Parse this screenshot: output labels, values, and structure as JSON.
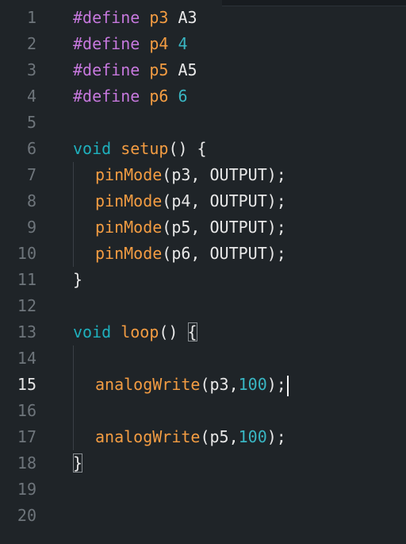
{
  "editor": {
    "current_line": 15,
    "line_numbers": [
      "1",
      "2",
      "3",
      "4",
      "5",
      "6",
      "7",
      "8",
      "9",
      "10",
      "11",
      "12",
      "13",
      "14",
      "15",
      "16",
      "17",
      "18",
      "19",
      "20"
    ],
    "lines": [
      {
        "define": "#define",
        "name": "p3",
        "value": "A3"
      },
      {
        "define": "#define",
        "name": "p4",
        "value": "4"
      },
      {
        "define": "#define",
        "name": "p5",
        "value": "A5"
      },
      {
        "define": "#define",
        "name": "p6",
        "value": "6"
      },
      {},
      {
        "type": "void",
        "func": "setup",
        "rest": "() {"
      },
      {
        "func": "pinMode",
        "rest": "(p3, OUTPUT);"
      },
      {
        "func": "pinMode",
        "rest": "(p4, OUTPUT);"
      },
      {
        "func": "pinMode",
        "rest": "(p5, OUTPUT);"
      },
      {
        "func": "pinMode",
        "rest": "(p6, OUTPUT);"
      },
      {
        "rest": "}"
      },
      {},
      {
        "type": "void",
        "func": "loop",
        "rest": "() ",
        "brace": "{"
      },
      {},
      {
        "func": "analogWrite",
        "args_pre": "(p3,",
        "num": "100",
        "args_post": ");"
      },
      {},
      {
        "func": "analogWrite",
        "args_pre": "(p5,",
        "num": "100",
        "args_post": ");"
      },
      {
        "brace": "}"
      },
      {},
      {}
    ]
  }
}
